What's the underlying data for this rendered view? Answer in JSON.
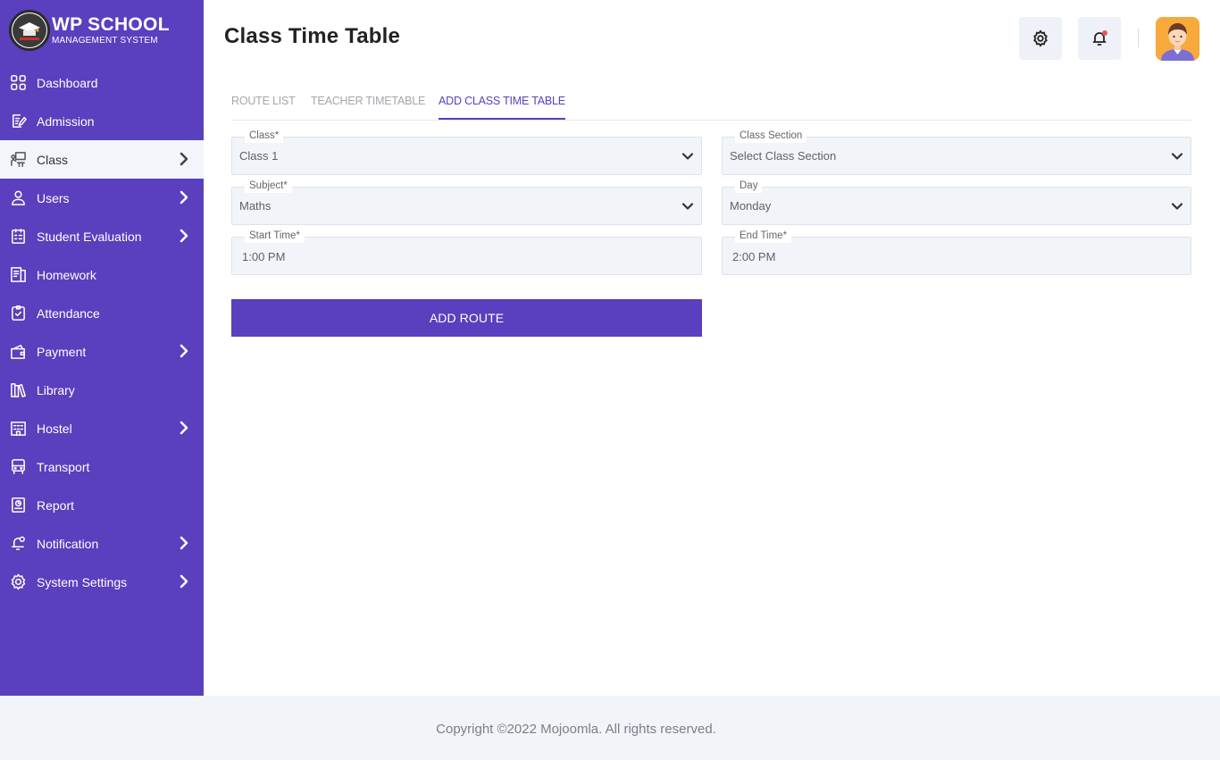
{
  "brand": {
    "title": "WP SCHOOL",
    "subtitle": "MANAGEMENT SYSTEM",
    "icon": "school-logo-icon"
  },
  "sidebar": {
    "items": [
      {
        "label": "Dashboard",
        "icon": "grid-icon",
        "has_submenu": false,
        "active": false
      },
      {
        "label": "Admission",
        "icon": "edit-document-icon",
        "has_submenu": false,
        "active": false
      },
      {
        "label": "Class",
        "icon": "classroom-icon",
        "has_submenu": true,
        "active": true
      },
      {
        "label": "Users",
        "icon": "user-icon",
        "has_submenu": true,
        "active": false
      },
      {
        "label": "Student Evaluation",
        "icon": "checklist-icon",
        "has_submenu": true,
        "active": false
      },
      {
        "label": "Homework",
        "icon": "books-icon",
        "has_submenu": false,
        "active": false
      },
      {
        "label": "Attendance",
        "icon": "clipboard-check-icon",
        "has_submenu": false,
        "active": false
      },
      {
        "label": "Payment",
        "icon": "wallet-icon",
        "has_submenu": true,
        "active": false
      },
      {
        "label": "Library",
        "icon": "library-icon",
        "has_submenu": false,
        "active": false
      },
      {
        "label": "Hostel",
        "icon": "building-icon",
        "has_submenu": true,
        "active": false
      },
      {
        "label": "Transport",
        "icon": "bus-icon",
        "has_submenu": false,
        "active": false
      },
      {
        "label": "Report",
        "icon": "report-icon",
        "has_submenu": false,
        "active": false
      },
      {
        "label": "Notification",
        "icon": "bell-icon",
        "has_submenu": true,
        "active": false
      },
      {
        "label": "System Settings",
        "icon": "gear-icon",
        "has_submenu": true,
        "active": false
      }
    ]
  },
  "header": {
    "title": "Class Time Table",
    "settings_icon": "gear-icon",
    "notification_icon": "bell-icon",
    "avatar_icon": "user-avatar-icon"
  },
  "tabs": [
    {
      "label": "ROUTE LIST",
      "active": false
    },
    {
      "label": "TEACHER TIMETABLE",
      "active": false
    },
    {
      "label": "ADD CLASS TIME TABLE",
      "active": true
    }
  ],
  "form": {
    "class": {
      "label": "Class*",
      "value": "Class 1"
    },
    "class_section": {
      "label": "Class Section",
      "value": "Select Class Section"
    },
    "subject": {
      "label": "Subject*",
      "value": "Maths"
    },
    "day": {
      "label": "Day",
      "value": "Monday"
    },
    "start_time": {
      "label": "Start Time*",
      "value": "1:00 PM"
    },
    "end_time": {
      "label": "End Time*",
      "value": "2:00 PM"
    },
    "submit_label": "ADD ROUTE"
  },
  "footer": {
    "text": "Copyright ©2022 Mojoomla. All rights reserved."
  },
  "colors": {
    "primary": "#5a3fbe",
    "sidebar_active_bg": "#f3f5fb",
    "field_bg": "#f1f4f9",
    "footer_bg": "#f1f4f9",
    "avatar_bg": "#f7a93b"
  }
}
